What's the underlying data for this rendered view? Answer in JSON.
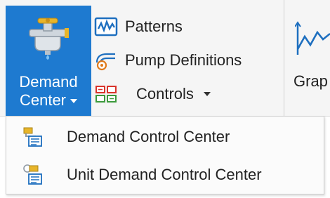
{
  "ribbon": {
    "demand_center": {
      "line1": "Demand",
      "line2": "Center",
      "icon": "water-tap-icon"
    },
    "patterns": {
      "label": "Patterns",
      "icon": "patterns-icon"
    },
    "pump_definitions": {
      "label": "Pump Definitions",
      "icon": "pump-definitions-icon"
    },
    "controls": {
      "label": "Controls",
      "icon": "controls-icon"
    },
    "graphs": {
      "label": "Grap",
      "icon": "graph-icon"
    }
  },
  "dropdown": {
    "items": [
      {
        "label": "Demand Control Center",
        "icon": "demand-control-center-icon"
      },
      {
        "label": "Unit Demand Control Center",
        "icon": "unit-demand-control-center-icon"
      }
    ]
  },
  "colors": {
    "accent": "#1e7ad0",
    "ribbon_bg": "#f5f5f5",
    "menu_bg": "#fbfbfb"
  }
}
